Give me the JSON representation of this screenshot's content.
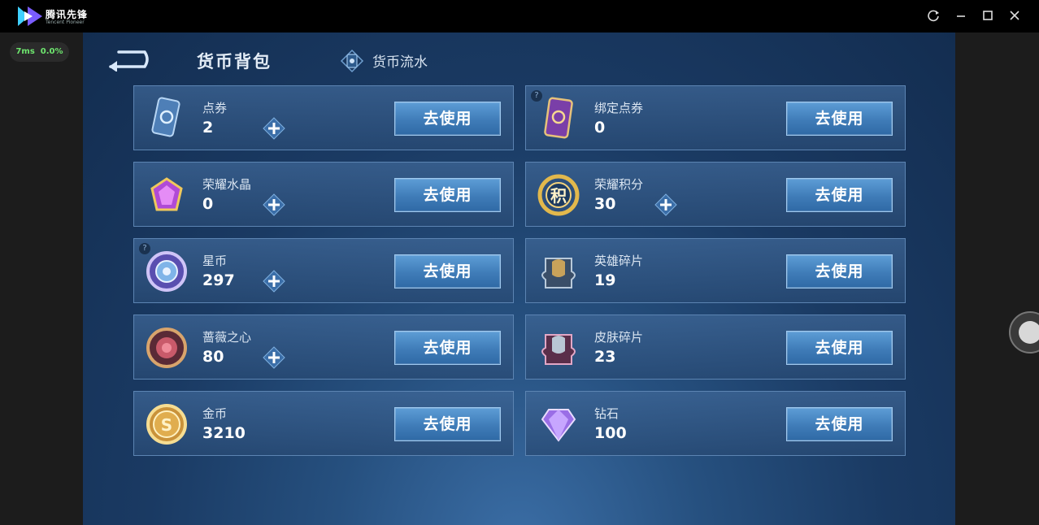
{
  "window": {
    "app_name": "腾讯先锋",
    "app_subtitle": "Tencent Pioneer",
    "refresh_icon": "refresh-icon",
    "minimize_icon": "minimize-icon",
    "maximize_icon": "maximize-icon",
    "close_icon": "close-icon"
  },
  "overlay": {
    "latency": "7ms",
    "loss": "0.0%"
  },
  "header": {
    "active_tab": "货币背包",
    "flow_tab": "货币流水"
  },
  "currencies": [
    {
      "name": "点券",
      "amount": "2",
      "button": "去使用",
      "icon": "coupon-card-icon",
      "has_plus": true,
      "has_help": false
    },
    {
      "name": "绑定点券",
      "amount": "0",
      "button": "去使用",
      "icon": "bound-coupon-card-icon",
      "has_plus": false,
      "has_help": true
    },
    {
      "name": "荣耀水晶",
      "amount": "0",
      "button": "去使用",
      "icon": "glory-crystal-icon",
      "has_plus": true,
      "has_help": false
    },
    {
      "name": "荣耀积分",
      "amount": "30",
      "button": "去使用",
      "icon": "glory-points-icon",
      "icon_text": "积",
      "has_plus": true,
      "has_help": false
    },
    {
      "name": "星币",
      "amount": "297",
      "button": "去使用",
      "icon": "star-coin-icon",
      "has_plus": true,
      "has_help": true
    },
    {
      "name": "英雄碎片",
      "amount": "19",
      "button": "去使用",
      "icon": "hero-fragment-icon",
      "has_plus": false,
      "has_help": false
    },
    {
      "name": "蔷薇之心",
      "amount": "80",
      "button": "去使用",
      "icon": "rose-heart-icon",
      "has_plus": true,
      "has_help": false
    },
    {
      "name": "皮肤碎片",
      "amount": "23",
      "button": "去使用",
      "icon": "skin-fragment-icon",
      "has_plus": false,
      "has_help": false
    },
    {
      "name": "金币",
      "amount": "3210",
      "button": "去使用",
      "icon": "gold-coin-icon",
      "icon_text": "S",
      "has_plus": false,
      "has_help": false
    },
    {
      "name": "钻石",
      "amount": "100",
      "button": "去使用",
      "icon": "diamond-icon",
      "has_plus": false,
      "has_help": false
    }
  ],
  "colors": {
    "accent": "#4a88c4",
    "panel_border": "#5c84b2",
    "background": "#1a3a63"
  }
}
